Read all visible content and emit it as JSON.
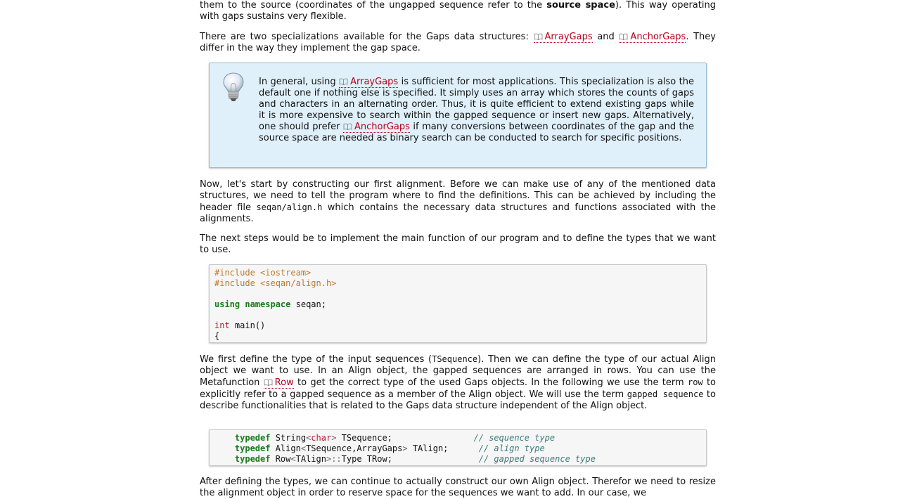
{
  "p0": {
    "a": "them to the source (coordinates of the ungapped sequence refer to the ",
    "b": "source space",
    "c": "). This way operating with gaps sustains very flexible."
  },
  "p1": {
    "a": "There are two specializations available for the Gaps data structures: ",
    "link1": "ArrayGaps",
    "b": " and ",
    "link2": "AnchorGaps",
    "c": ". They differ in the way they implement the gap space."
  },
  "hint": {
    "a": "In general, using ",
    "link1": "ArrayGaps",
    "b": " is sufficient for most applications. This specialization is also the default one if nothing else is specified. It simply uses an array which stores the counts of gaps and characters in an alternating order. Thus, it is quite efficient to extend existing gaps while it is more expensive to search within the gapped sequence or insert new gaps. Alternatively, one should prefer ",
    "link2": "AnchorGaps",
    "c": " if many conversions between coordinates of the gap and the source space are needed as binary search can be conducted to search for specific positions."
  },
  "p2": {
    "a": "Now, let's start by constructing our first alignment. Before we can make use of any of the mentioned data structures, we need to tell the program where to find the definitions. This can be achieved by including the header file ",
    "code": "seqan/align.h",
    "b": " which contains the necessary data structures and functions associated with the alignments."
  },
  "p3": {
    "a": "The next steps would be to implement the main function of our program and to define the types that we want to use."
  },
  "code1": {
    "l1": "#include <iostream>",
    "l2": "#include <seqan/align.h>",
    "l4a": "using",
    "l4b": "namespace",
    "l4c": " seqan;",
    "l6a": "int",
    "l6b": " main()",
    "l7": "{"
  },
  "p4": {
    "a": "We first define the type of the input sequences (",
    "code1": "TSequence",
    "b": "). Then we can define the type of our actual Align object we want to use. In an Align object, the gapped sequences are arranged in rows. You can use the Metafunction ",
    "link": "Row",
    "c": " to get the correct type of the used Gaps objects. In the following we use the term ",
    "code2": "row",
    "d": " to explicitly refer to a gapped sequence as a member of the Align object. We will use the term ",
    "code3": "gapped sequence",
    "e": " to describe functionalities that is related to the Gaps data structure independent of the Align object."
  },
  "code2": {
    "typedef": "typedef",
    "r1a": " String",
    "r1b": "<",
    "r1c": "char",
    "r1d": ">",
    "r1e": " TSequence;                ",
    "r1f": "// sequence type",
    "r2a": " Align",
    "r2b": "<",
    "r2c": "TSequence,ArrayGaps",
    "r2d": ">",
    "r2e": " TAlign;      ",
    "r2f": "// align type",
    "r3a": " Row",
    "r3b": "<",
    "r3c": "TAlign",
    "r3d": ">::",
    "r3e": "Type TRow;                 ",
    "r3f": "// gapped sequence type"
  },
  "p5": {
    "a": "After defining the types, we can continue to actually construct our own Align object. Therefor we need to resize the alignment object in order to reserve space for the sequences we want to add. In our case, we"
  },
  "icons": {
    "book": "book-icon",
    "bulb": "lightbulb-icon"
  },
  "colors": {
    "link": "#b3001b",
    "hint_bg": "#e0f0fa",
    "code_bg": "#f6f6f6",
    "keyword": "#1a7a1a",
    "preprocessor": "#c0782a",
    "type": "#c0152b",
    "comment": "#3a7a7a"
  }
}
